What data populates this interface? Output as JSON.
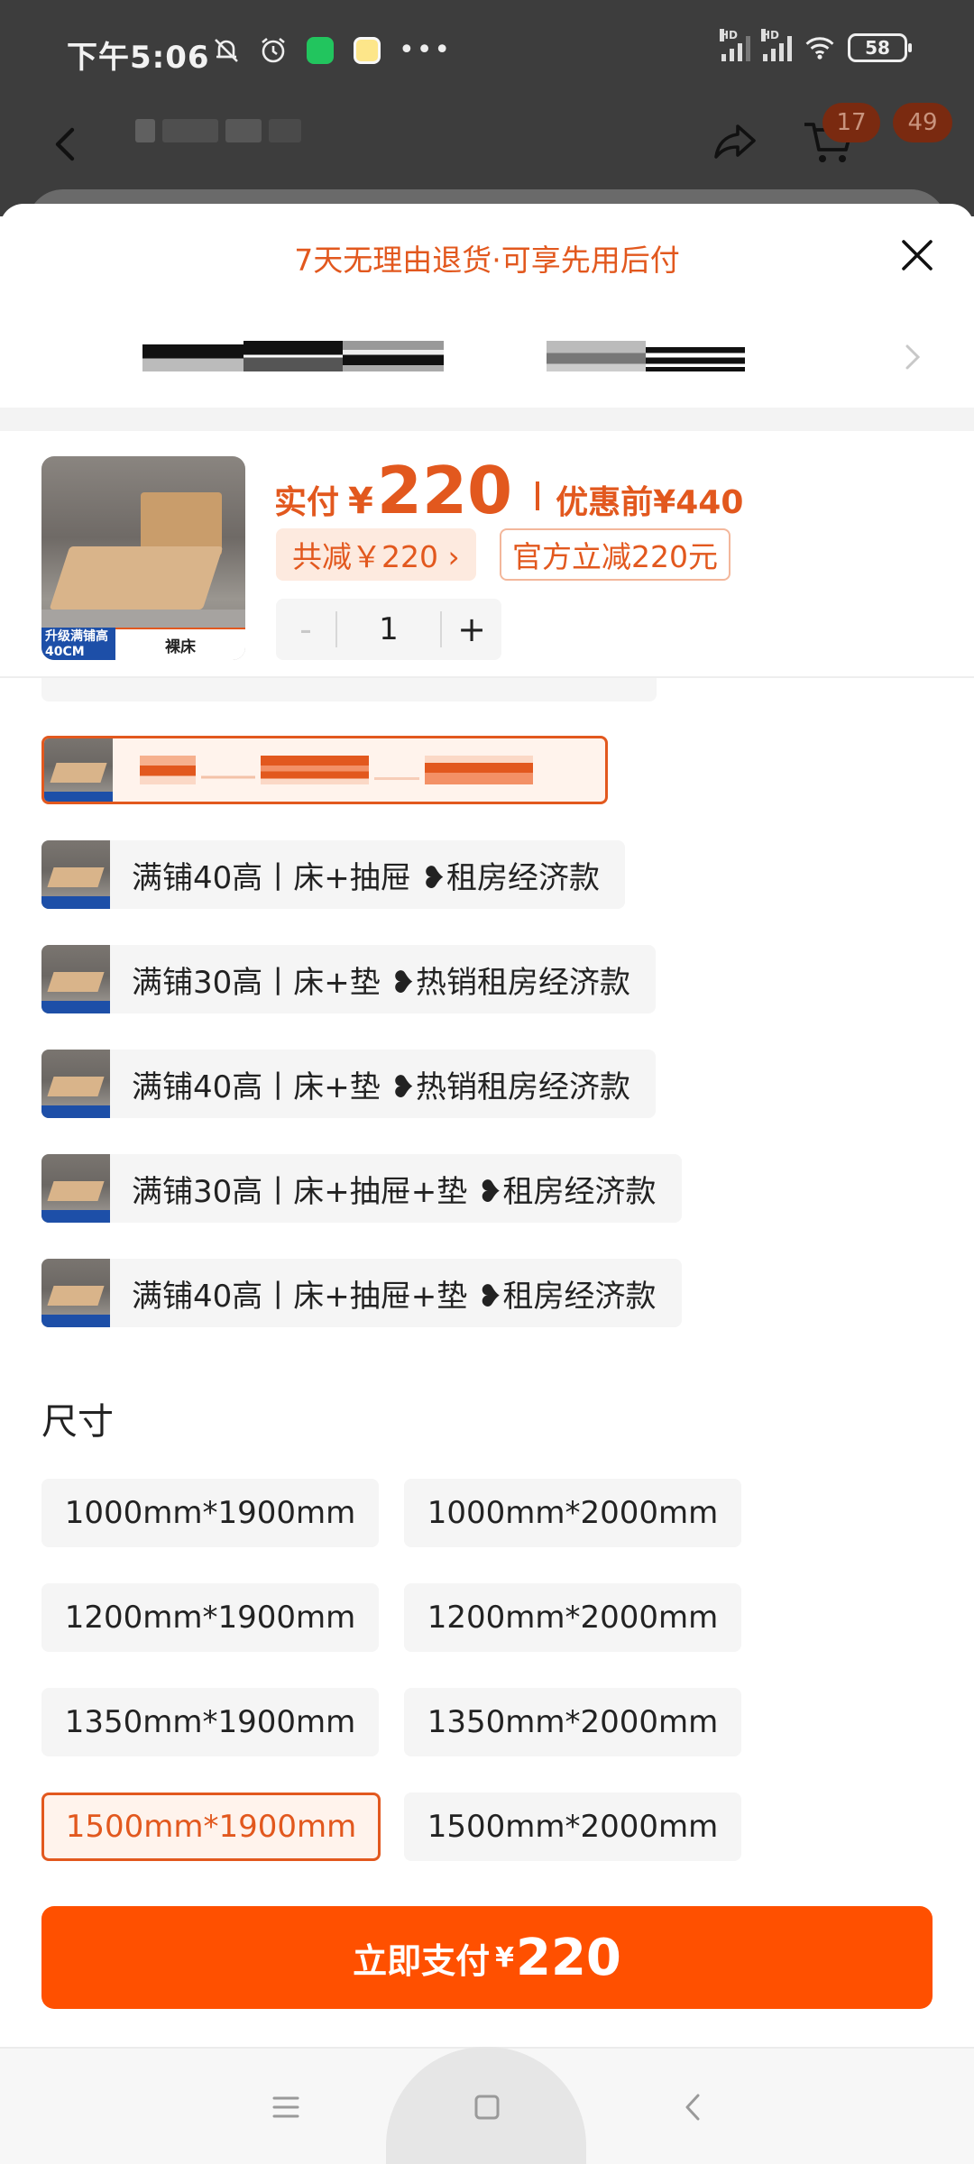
{
  "status_bar": {
    "time": "下午5:06",
    "battery": "58",
    "left_icons": [
      "mute-bell-icon",
      "alarm-icon",
      "app-green-icon",
      "app-yellow-icon",
      "more-dots-icon"
    ],
    "right_icons": [
      "hd-signal-icon",
      "hd-signal-icon",
      "wifi-icon",
      "battery-icon"
    ]
  },
  "top_nav": {
    "cart_badge": "17",
    "message_badge": "49"
  },
  "sheet": {
    "banner": "7天无理由退货·可享先用后付",
    "price": {
      "prefix": "实付",
      "currency": "¥",
      "amount": "220",
      "before_label": "优惠前",
      "before_currency": "¥",
      "before_amount": "440"
    },
    "thumbnail": {
      "label_left": "升级满铺高40CM",
      "label_right": "裸床"
    },
    "discount_chip": "共减￥220 ›",
    "official_chip": "官方立减220元",
    "quantity": {
      "minus": "-",
      "value": "1",
      "plus": "+"
    },
    "variants": [
      {
        "label": "满铺40高丨床+抽屉 ❥租房经济款"
      },
      {
        "label": "满铺30高丨床+垫 ❥热销租房经济款"
      },
      {
        "label": "满铺40高丨床+垫 ❥热销租房经济款"
      },
      {
        "label": "满铺30高丨床+抽屉+垫 ❥租房经济款"
      },
      {
        "label": "满铺40高丨床+抽屉+垫 ❥租房经济款"
      }
    ],
    "size_title": "尺寸",
    "sizes": [
      "1000mm*1900mm",
      "1000mm*2000mm",
      "1200mm*1900mm",
      "1200mm*2000mm",
      "1350mm*1900mm",
      "1350mm*2000mm",
      "1500mm*1900mm",
      "1500mm*2000mm"
    ],
    "selected_size": "1500mm*1900mm",
    "pay_button": {
      "label": "立即支付",
      "currency": "¥",
      "amount": "220"
    }
  },
  "colors": {
    "accent": "#e2581e",
    "pay_button": "#ff5000",
    "chip_bg": "#fdeadf",
    "option_bg": "#f5f5f5"
  }
}
